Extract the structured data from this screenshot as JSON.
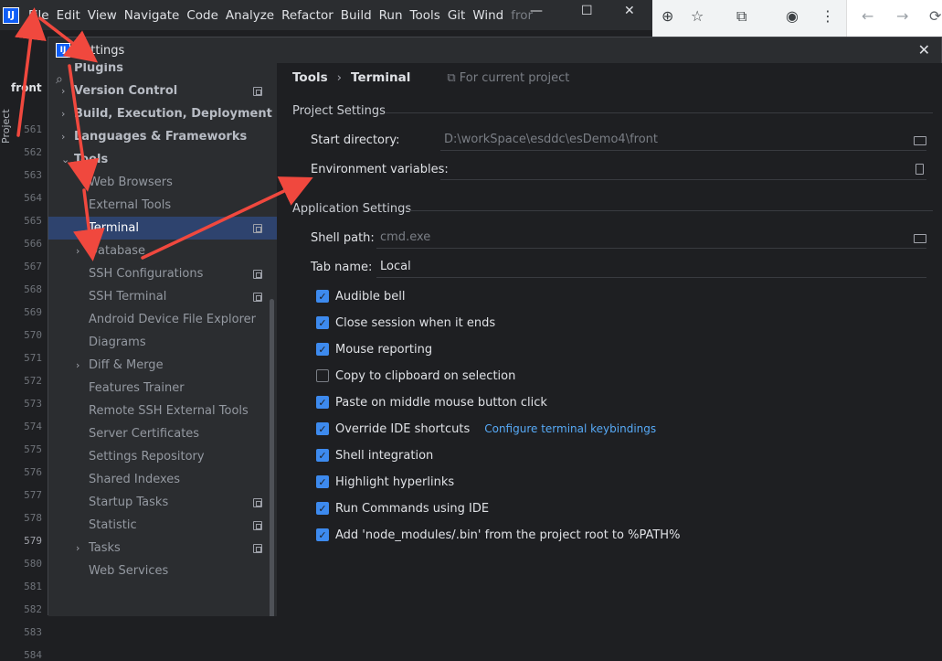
{
  "menubar": {
    "logo_text": "IJ",
    "items": [
      {
        "label": "File"
      },
      {
        "label": "Edit"
      },
      {
        "label": "View"
      },
      {
        "label": "Navigate"
      },
      {
        "label": "Code"
      },
      {
        "label": "Analyze"
      },
      {
        "label": "Refactor"
      },
      {
        "label": "Build"
      },
      {
        "label": "Run"
      },
      {
        "label": "Tools"
      },
      {
        "label": "Git"
      },
      {
        "label": "Wind"
      }
    ],
    "project_hint": "fror",
    "minimize": "—",
    "maximize": "☐",
    "close": "✕"
  },
  "browser": {
    "zoom_icon": "⊕",
    "star_icon": "☆",
    "ext_icon": "⧉",
    "profile_icon": "◉",
    "more_icon": "⋮",
    "back_icon": "←",
    "forward_icon": "→",
    "refresh_icon": "⟳"
  },
  "left_strip": {
    "project_label": "Project",
    "crumb": "front",
    "lines": [
      "561",
      "562",
      "563",
      "564",
      "565",
      "566",
      "567",
      "568",
      "569",
      "570",
      "571",
      "572",
      "573",
      "574",
      "575",
      "576",
      "577",
      "578",
      "579",
      "580",
      "581",
      "582",
      "583",
      "584"
    ],
    "current_line": "579"
  },
  "dialog": {
    "logo_text": "IJ",
    "title": "Settings",
    "close_icon": "✕",
    "search_icon": "⌕"
  },
  "tree": [
    {
      "label": "Plugins",
      "level": 0,
      "style": "bold",
      "chev": ""
    },
    {
      "label": "Version Control",
      "level": 0,
      "style": "bold",
      "chev": "›",
      "copy": true
    },
    {
      "label": "Build, Execution, Deployment",
      "level": 0,
      "style": "bold",
      "chev": "›"
    },
    {
      "label": "Languages & Frameworks",
      "level": 0,
      "style": "bold",
      "chev": "›"
    },
    {
      "label": "Tools",
      "level": 0,
      "style": "bold",
      "chev": "⌄"
    },
    {
      "label": "Web Browsers",
      "level": 1,
      "style": "dim"
    },
    {
      "label": "External Tools",
      "level": 1,
      "style": "dim"
    },
    {
      "label": "Terminal",
      "level": 1,
      "style": "white",
      "selected": true,
      "copy": true
    },
    {
      "label": "Database",
      "level": 1,
      "style": "dim",
      "chev": "›"
    },
    {
      "label": "SSH Configurations",
      "level": 1,
      "style": "dim",
      "copy": true
    },
    {
      "label": "SSH Terminal",
      "level": 1,
      "style": "dim",
      "copy": true
    },
    {
      "label": "Android Device File Explorer",
      "level": 1,
      "style": "dim"
    },
    {
      "label": "Diagrams",
      "level": 1,
      "style": "dim"
    },
    {
      "label": "Diff & Merge",
      "level": 1,
      "style": "dim",
      "chev": "›"
    },
    {
      "label": "Features Trainer",
      "level": 1,
      "style": "dim"
    },
    {
      "label": "Remote SSH External Tools",
      "level": 1,
      "style": "dim"
    },
    {
      "label": "Server Certificates",
      "level": 1,
      "style": "dim"
    },
    {
      "label": "Settings Repository",
      "level": 1,
      "style": "dim"
    },
    {
      "label": "Shared Indexes",
      "level": 1,
      "style": "dim"
    },
    {
      "label": "Startup Tasks",
      "level": 1,
      "style": "dim",
      "copy": true
    },
    {
      "label": "Statistic",
      "level": 1,
      "style": "dim",
      "copy": true
    },
    {
      "label": "Tasks",
      "level": 1,
      "style": "dim",
      "chev": "›",
      "copy": true
    },
    {
      "label": "Web Services",
      "level": 1,
      "style": "dim"
    }
  ],
  "content": {
    "crumb_parent": "Tools",
    "crumb_sep": "›",
    "crumb_current": "Terminal",
    "crumb_scope": "For current project",
    "project_settings": "Project Settings",
    "start_dir_label": "Start directory:",
    "start_dir_value": "D:\\workSpace\\esddc\\esDemo4\\front",
    "env_vars_label": "Environment variables:",
    "env_vars_value": "",
    "app_settings": "Application Settings",
    "shell_path_label": "Shell path:",
    "shell_path_value": "cmd.exe",
    "tab_name_label": "Tab name:",
    "tab_name_value": "Local",
    "checkboxes": [
      {
        "label": "Audible bell",
        "checked": true
      },
      {
        "label": "Close session when it ends",
        "checked": true
      },
      {
        "label": "Mouse reporting",
        "checked": true
      },
      {
        "label": "Copy to clipboard on selection",
        "checked": false
      },
      {
        "label": "Paste on middle mouse button click",
        "checked": true
      },
      {
        "label": "Override IDE shortcuts",
        "checked": true,
        "link": "Configure terminal keybindings"
      },
      {
        "label": "Shell integration",
        "checked": true
      },
      {
        "label": "Highlight hyperlinks",
        "checked": true
      },
      {
        "label": "Run Commands using IDE",
        "checked": true
      },
      {
        "label": "Add 'node_modules/.bin' from the project root to %PATH%",
        "checked": true
      }
    ],
    "check_glyph": "✓"
  },
  "colors": {
    "accent": "#3d8aee",
    "selection": "#2e436e",
    "arrow": "#f0483e"
  }
}
